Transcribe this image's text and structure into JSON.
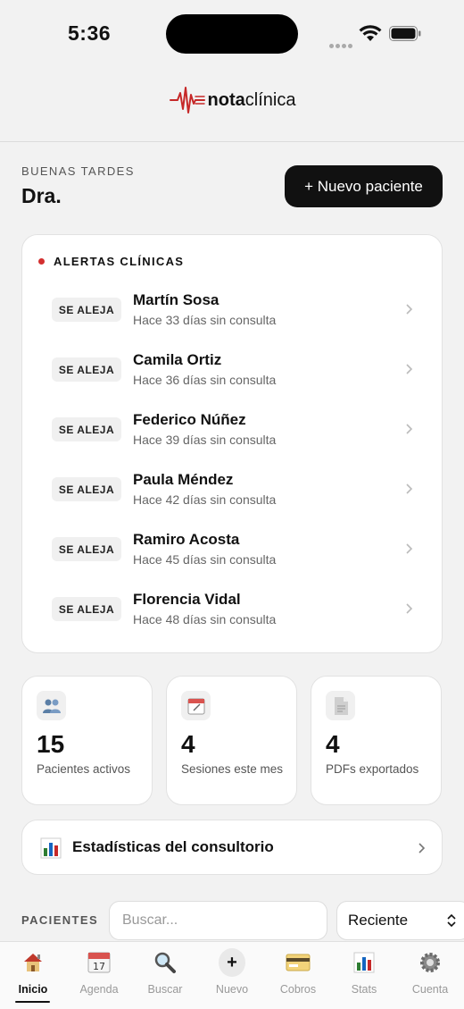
{
  "status_bar": {
    "time": "5:36"
  },
  "brand": {
    "name_bold": "nota",
    "name_regular": "clínica",
    "accent": "#c62828"
  },
  "greeting": {
    "label": "BUENAS TARDES",
    "name": "Dra."
  },
  "actions": {
    "new_patient_label": "+ Nuevo paciente"
  },
  "alerts": {
    "title": "ALERTAS CLÍNICAS",
    "items": [
      {
        "badge": "SE ALEJA",
        "name": "Martín Sosa",
        "subtitle": "Hace 33 días sin consulta"
      },
      {
        "badge": "SE ALEJA",
        "name": "Camila Ortiz",
        "subtitle": "Hace 36 días sin consulta"
      },
      {
        "badge": "SE ALEJA",
        "name": "Federico Núñez",
        "subtitle": "Hace 39 días sin consulta"
      },
      {
        "badge": "SE ALEJA",
        "name": "Paula Méndez",
        "subtitle": "Hace 42 días sin consulta"
      },
      {
        "badge": "SE ALEJA",
        "name": "Ramiro Acosta",
        "subtitle": "Hace 45 días sin consulta"
      },
      {
        "badge": "SE ALEJA",
        "name": "Florencia Vidal",
        "subtitle": "Hace 48 días sin consulta"
      }
    ]
  },
  "stats": [
    {
      "icon": "people-icon",
      "value": "15",
      "label": "Pacientes activos"
    },
    {
      "icon": "calendar-icon",
      "value": "4",
      "label": "Sesiones este mes"
    },
    {
      "icon": "document-icon",
      "value": "4",
      "label": "PDFs exportados"
    }
  ],
  "stats_link": {
    "icon": "bar-chart-icon",
    "label": "Estadísticas del consultorio"
  },
  "patients": {
    "label": "PACIENTES",
    "search_placeholder": "Buscar...",
    "sort_value": "Reciente"
  },
  "tabs": [
    {
      "icon": "house-icon",
      "label": "Inicio",
      "active": true
    },
    {
      "icon": "calendar-icon",
      "label": "Agenda"
    },
    {
      "icon": "magnifier-icon",
      "label": "Buscar"
    },
    {
      "icon": "plus-icon",
      "label": "Nuevo"
    },
    {
      "icon": "credit-card-icon",
      "label": "Cobros"
    },
    {
      "icon": "bar-chart-icon",
      "label": "Stats"
    },
    {
      "icon": "gear-icon",
      "label": "Cuenta"
    }
  ]
}
